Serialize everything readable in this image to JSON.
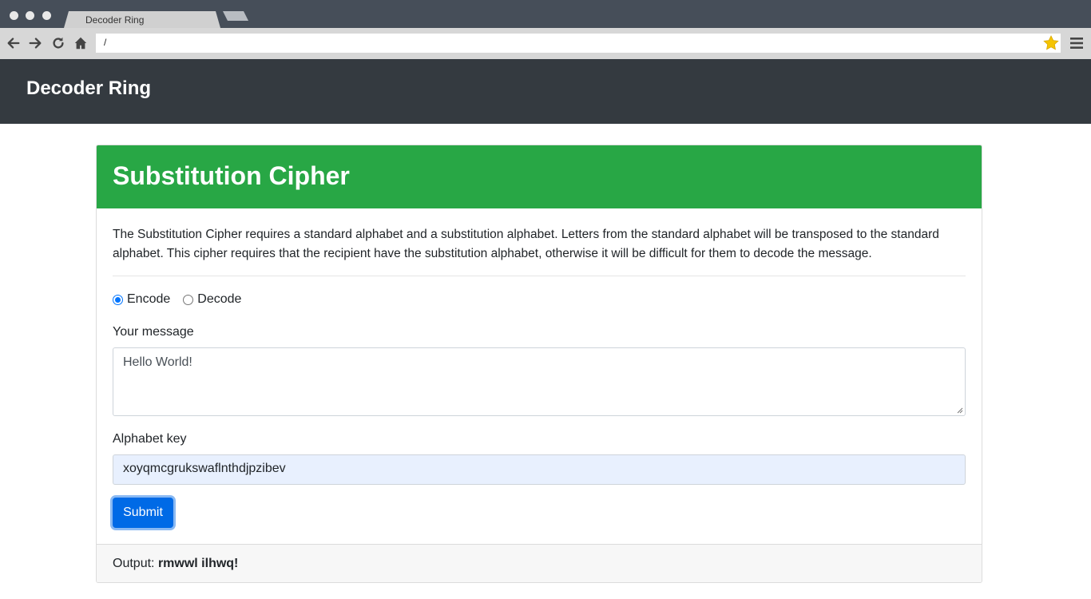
{
  "browser": {
    "tab_title": "Decoder Ring",
    "url": "/"
  },
  "navbar": {
    "brand": "Decoder Ring"
  },
  "card": {
    "title": "Substitution Cipher",
    "description": "The Substitution Cipher requires a standard alphabet and a substitution alphabet. Letters from the standard alphabet will be transposed to the standard alphabet. This cipher requires that the recipient have the substitution alphabet, otherwise it will be difficult for them to decode the message.",
    "mode_options": [
      {
        "label": "Encode",
        "checked": true
      },
      {
        "label": "Decode",
        "checked": false
      }
    ],
    "message_label": "Your message",
    "message_value": "Hello World!",
    "alphabet_label": "Alphabet key",
    "alphabet_value": "xoyqmcgrukswaflnthdjpzibev",
    "submit_label": "Submit",
    "output_label": "Output:",
    "output_value": "rmwwl ilhwq!"
  },
  "colors": {
    "header_green": "#28a745",
    "navbar_dark": "#343a40",
    "button_blue": "#006ae6"
  },
  "icons": [
    "back-arrow-icon",
    "forward-arrow-icon",
    "reload-icon",
    "home-icon",
    "bookmark-star-icon",
    "hamburger-menu-icon"
  ]
}
